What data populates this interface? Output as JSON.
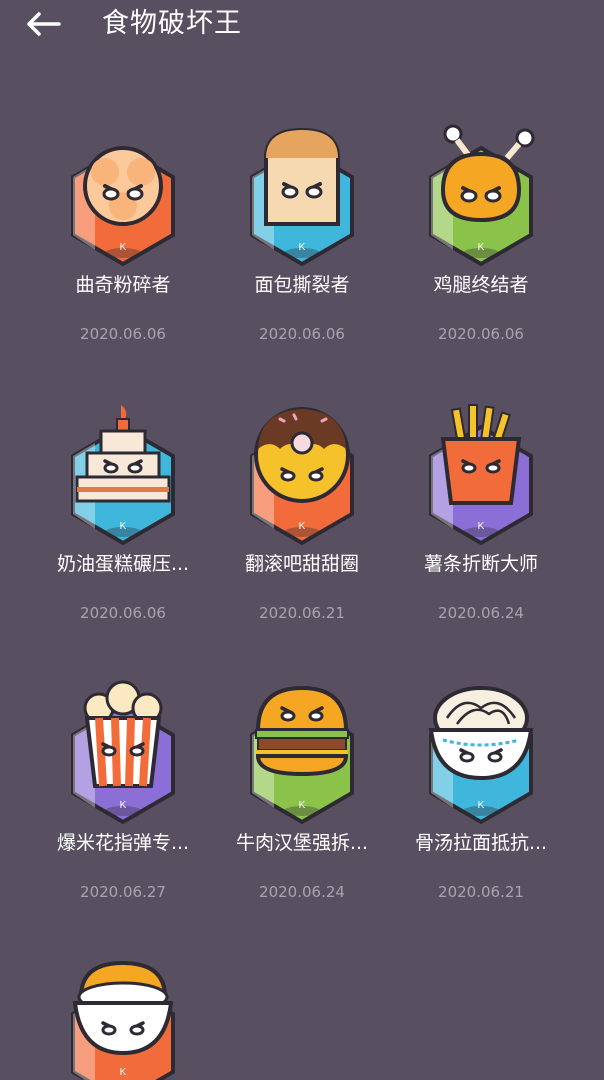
{
  "header": {
    "title": "食物破坏王",
    "back_icon": "arrow-left-icon"
  },
  "badges": [
    {
      "name": "曲奇粉碎者",
      "date": "2020.06.06",
      "food": "cookie",
      "hex_color": "#f26b3a"
    },
    {
      "name": "面包撕裂者",
      "date": "2020.06.06",
      "food": "bread",
      "hex_color": "#3fb6dc"
    },
    {
      "name": "鸡腿终结者",
      "date": "2020.06.06",
      "food": "drumstick",
      "hex_color": "#8bc34a"
    },
    {
      "name": "奶油蛋糕碾压...",
      "date": "2020.06.06",
      "food": "cake",
      "hex_color": "#3fb6dc"
    },
    {
      "name": "翻滚吧甜甜圈",
      "date": "2020.06.21",
      "food": "donut",
      "hex_color": "#f26b3a"
    },
    {
      "name": "薯条折断大师",
      "date": "2020.06.24",
      "food": "fries",
      "hex_color": "#8b6fd6"
    },
    {
      "name": "爆米花指弹专...",
      "date": "2020.06.27",
      "food": "popcorn",
      "hex_color": "#8b6fd6"
    },
    {
      "name": "牛肉汉堡强拆...",
      "date": "2020.06.24",
      "food": "burger",
      "hex_color": "#8bc34a"
    },
    {
      "name": "骨汤拉面抵抗...",
      "date": "2020.06.21",
      "food": "noodles",
      "hex_color": "#3fb6dc"
    },
    {
      "name": "",
      "date": "",
      "food": "rice",
      "hex_color": "#f26b3a"
    }
  ]
}
